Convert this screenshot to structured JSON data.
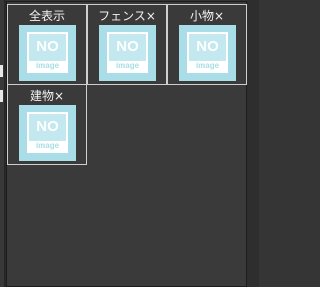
{
  "tiles": [
    {
      "label": "全表示",
      "thumbnail": {
        "line1": "NO",
        "line2": "image"
      }
    },
    {
      "label": "フェンス×",
      "thumbnail": {
        "line1": "NO",
        "line2": "image"
      }
    },
    {
      "label": "小物×",
      "thumbnail": {
        "line1": "NO",
        "line2": "image"
      }
    },
    {
      "label": "建物×",
      "thumbnail": {
        "line1": "NO",
        "line2": "image"
      }
    }
  ],
  "colors": {
    "background": "#353535",
    "panel": "#3a3a3a",
    "tile_border": "#cfcfcf",
    "placeholder": "#a9dde8",
    "label_text": "#f2f2f2"
  }
}
